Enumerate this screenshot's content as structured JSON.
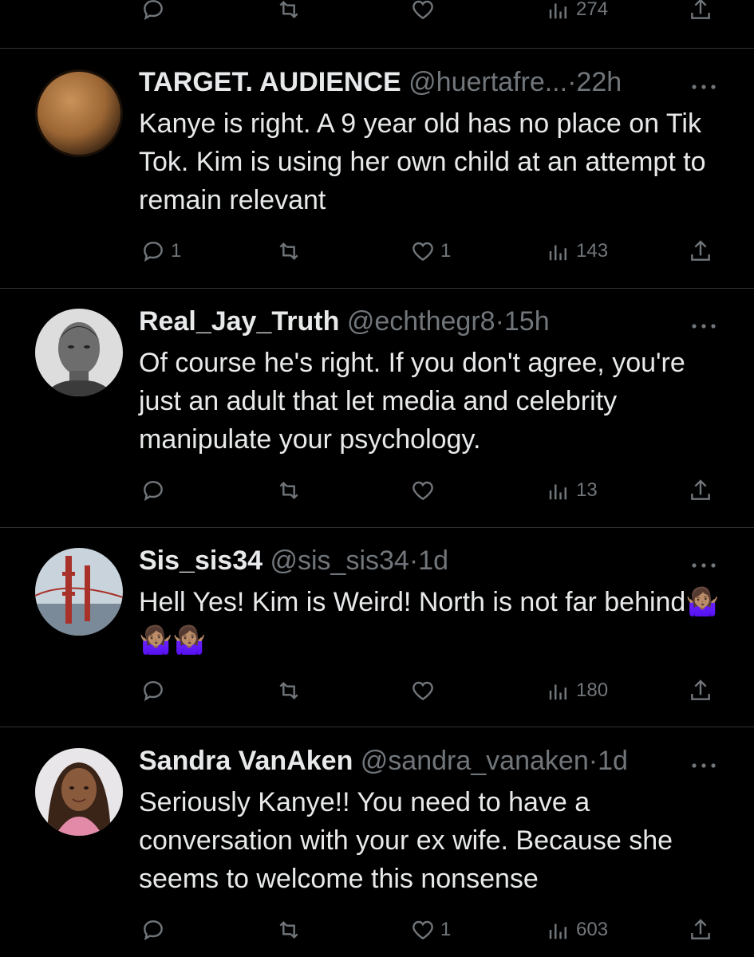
{
  "top_actions": {
    "views_count": "274"
  },
  "tweets": [
    {
      "name": "TARGET. AUDIENCE",
      "handle": "@huertafre...",
      "dot": "·",
      "time": "22h",
      "text": "Kanye is right. A 9 year old has no place on Tik Tok. Kim is using her own child at an attempt to remain relevant",
      "replies": "1",
      "likes": "1",
      "views": "143"
    },
    {
      "name": "Real_Jay_Truth",
      "handle": "@echthegr8",
      "dot": "·",
      "time": "15h",
      "text": "Of course he's right. If you don't agree, you're just an adult that let media and celebrity manipulate your psychology.",
      "replies": "",
      "likes": "",
      "views": "13"
    },
    {
      "name": "Sis_sis34",
      "handle": "@sis_sis34",
      "dot": "·",
      "time": "1d",
      "text": "Hell Yes! Kim is Weird! North is not far behind🤷🏽‍♀️🤷🏽‍♀️🤷🏽‍♀️",
      "replies": "",
      "likes": "",
      "views": "180"
    },
    {
      "name": "Sandra VanAken",
      "handle": "@sandra_vanaken",
      "dot": "·",
      "time": "1d",
      "text": "Seriously Kanye!! You need to have a conversation with your ex wife. Because she seems to welcome this nonsense",
      "replies": "",
      "likes": "1",
      "views": "603"
    }
  ],
  "colors": {
    "background": "#000000",
    "text": "#e7e9ea",
    "muted": "#71767b",
    "divider": "#2f3336"
  },
  "icons": [
    "reply-icon",
    "retweet-icon",
    "like-icon",
    "views-icon",
    "share-icon",
    "more-icon"
  ]
}
